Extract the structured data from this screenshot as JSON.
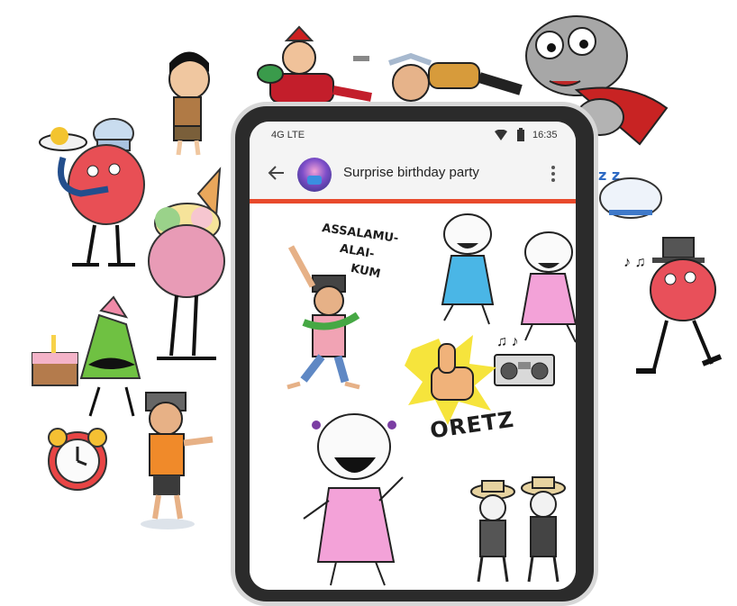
{
  "status_bar": {
    "network": "4G LTE",
    "time": "16:35"
  },
  "chat": {
    "title": "Surprise birthday party"
  },
  "stickers": {
    "greeting_text_1": "ASSALAMU-",
    "greeting_text_2": "ALAI-",
    "greeting_text_3": "KUM",
    "thumbs_text": "ORETZ"
  },
  "icons": {
    "back": "back-arrow-icon",
    "more": "more-vert-icon",
    "wifi": "wifi-icon",
    "battery": "battery-icon"
  },
  "colors": {
    "accent": "#e84a2c",
    "phone_body": "#2b2b2b",
    "app_bar": "#f4f4f4"
  }
}
